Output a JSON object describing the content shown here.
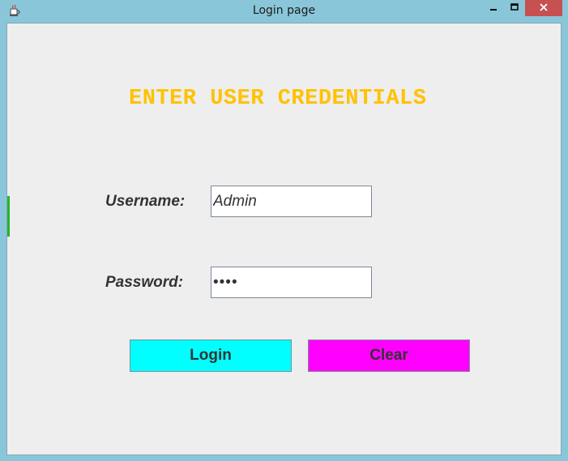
{
  "window": {
    "title": "Login page",
    "icon": "java-coffee-cup-icon",
    "controls": [
      "minimize-icon",
      "maximize-icon",
      "close-icon"
    ]
  },
  "form": {
    "heading": "ENTER USER CREDENTIALS",
    "username_label": "Username:",
    "username_value": "Admin",
    "password_label": "Password:",
    "password_value": "••••",
    "login_label": "Login",
    "clear_label": "Clear"
  },
  "colors": {
    "heading": "#ffc200",
    "login_button": "#00ffff",
    "clear_button": "#ff00ff",
    "client_bg": "#eeeeee",
    "frame": "#8ac6d9"
  }
}
